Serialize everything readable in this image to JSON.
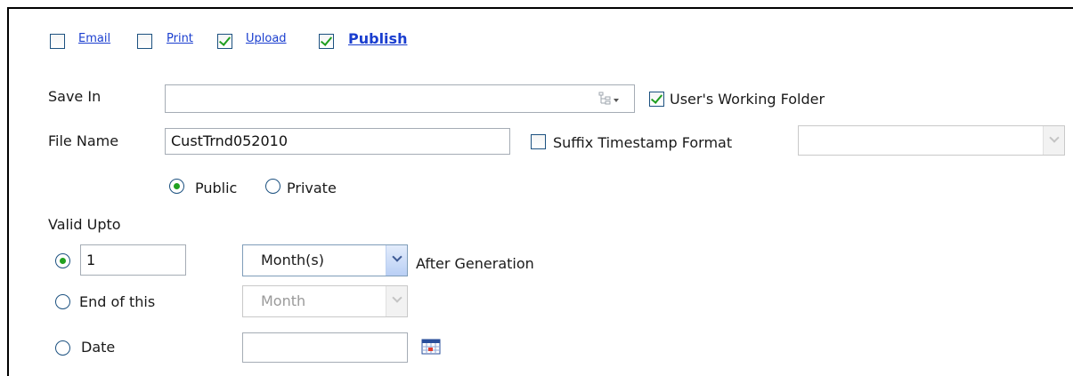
{
  "share_options": [
    {
      "label": "Email",
      "checked": false
    },
    {
      "label": "Print",
      "checked": false
    },
    {
      "label": "Upload",
      "checked": true
    },
    {
      "label": "Publish",
      "checked": true
    }
  ],
  "save_in": {
    "label": "Save In",
    "value": "",
    "users_working_folder": {
      "label": "User's Working Folder",
      "checked": true
    }
  },
  "file_name": {
    "label": "File Name",
    "value": "CustTrnd052010",
    "suffix_timestamp": {
      "label": "Suffix Timestamp Format",
      "checked": false,
      "value": ""
    }
  },
  "visibility": {
    "public": {
      "label": "Public",
      "selected": true
    },
    "private": {
      "label": "Private",
      "selected": false
    }
  },
  "valid_upto": {
    "label": "Valid Upto",
    "after": {
      "value": "1",
      "unit": "Month(s)",
      "suffix": "After Generation",
      "selected": true
    },
    "end_of": {
      "label": "End of this",
      "unit": "Month",
      "selected": false
    },
    "date": {
      "label": "Date",
      "value": "",
      "selected": false
    }
  },
  "colors": {
    "link": "#1a3ecf",
    "check": "#1f9e1f",
    "border": "#1c5180"
  }
}
